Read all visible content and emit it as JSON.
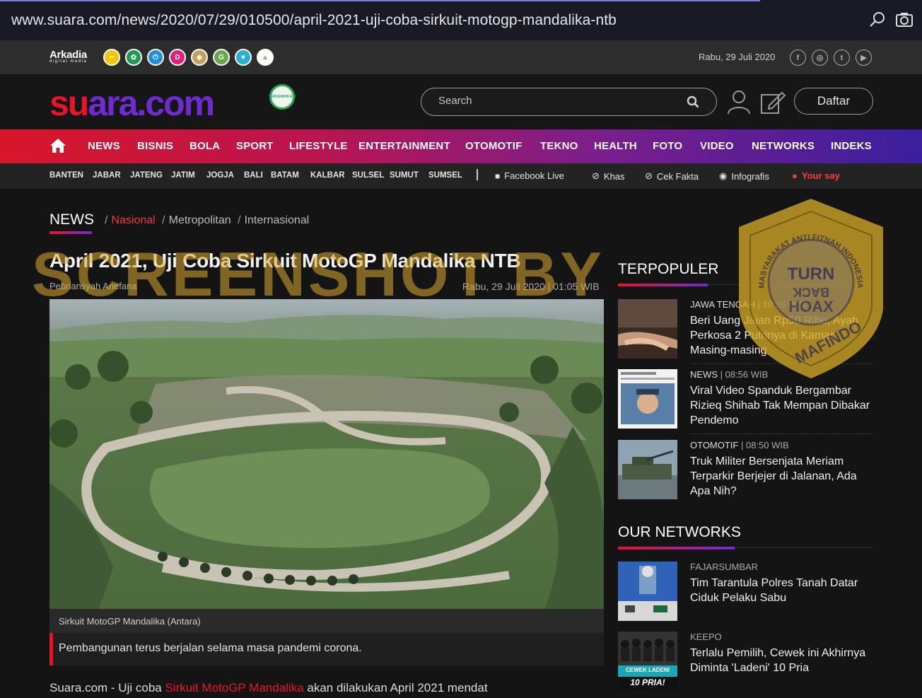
{
  "browser": {
    "url": "www.suara.com/news/2020/07/29/010500/april-2021-uji-coba-sirkuit-motogp-mandalika-ntb"
  },
  "topbar": {
    "arkadia": "Arkadia",
    "arkadia_sub": "digital media",
    "date": "Rabu, 29 Juli 2020",
    "brands": [
      "mata",
      "flower",
      "power",
      "D",
      "crest",
      "G",
      "chat",
      "triangle"
    ],
    "brand_colors": [
      "#f6c500",
      "#1d9a55",
      "#1f8fdc",
      "#e0207a",
      "#c7a05a",
      "#6aa84f",
      "#2ab0d0",
      "#ffffff"
    ],
    "social": [
      "facebook-icon",
      "instagram-icon",
      "twitter-icon",
      "youtube-icon"
    ]
  },
  "header": {
    "logo_part1": "su",
    "logo_part2": "ara",
    "logo_part3": ".com",
    "badge": "TERVERIFIKASI",
    "search_placeholder": "Search",
    "register_label": "Daftar"
  },
  "nav": {
    "items": [
      "NEWS",
      "BISNIS",
      "BOLA",
      "SPORT",
      "LIFESTYLE",
      "ENTERTAINMENT",
      "OTOMOTIF",
      "TEKNO",
      "HEALTH",
      "FOTO",
      "VIDEO",
      "NETWORKS",
      "INDEKS"
    ]
  },
  "subnav": {
    "regions": [
      "BANTEN",
      "JABAR",
      "JATENG",
      "JATIM",
      "JOGJA",
      "BALI",
      "BATAM",
      "KALBAR",
      "SULSEL",
      "SUMUT",
      "SUMSEL"
    ],
    "features": [
      "Facebook Live",
      "Khas",
      "Cek Fakta",
      "Infografis",
      "Your say"
    ]
  },
  "section": {
    "title": "NEWS",
    "crumbs": [
      "Nasional",
      "Metropolitan",
      "Internasional"
    ]
  },
  "article": {
    "title": "April 2021, Uji Coba Sirkuit MotoGP Mandalika NTB",
    "author": "Pebriansyah Ariefana",
    "date": "Rabu, 29 Juli 2020 | 01:05 WIB",
    "caption": "Sirkuit MotoGP Mandalika (Antara)",
    "lead": "Pembangunan terus berjalan selama masa pandemi corona.",
    "body_start": "Suara.com - Uji coba ",
    "body_link": "Sirkuit MotoGP Mandalika",
    "body_end": " akan dilakukan April 2021 mendat"
  },
  "watermark": "SCREENSHOT BY",
  "stamp": {
    "ring": "MASYARAKAT ANTI FITNAH INDONESIA",
    "center_1": "TURN",
    "center_2": "BACK",
    "center_3": "HOAX",
    "bottom": "MAFINDO"
  },
  "terpopuler": {
    "title": "TERPOPULER",
    "items": [
      {
        "cat": "JAWA TENGAH",
        "time": "10:26 WIB",
        "title": "Beri Uang Jajan Rp50 Ribu, Ayah Perkosa 2 Putrinya di Kamar Masing-masing"
      },
      {
        "cat": "NEWS",
        "time": "08:56 WIB",
        "title": "Viral Video Spanduk Bergambar Rizieq Shihab Tak Mempan Dibakar Pendemo"
      },
      {
        "cat": "OTOMOTIF",
        "time": "08:50 WIB",
        "title": "Truk Militer Bersenjata Meriam Terparkir Berjejer di Jalanan, Ada Apa Nih?"
      }
    ]
  },
  "networks": {
    "title": "OUR NETWORKS",
    "items": [
      {
        "source": "FAJARSUMBAR",
        "title": "Tim Tarantula Polres Tanah Datar Ciduk Pelaku Sabu"
      },
      {
        "source": "KEEPO",
        "title": "Terlalu Pemilih, Cewek ini Akhirnya Diminta 'Ladeni' 10 Pria",
        "thumb_text_1": "CEWEK LADENI",
        "thumb_text_2": "10 PRIA!"
      }
    ]
  }
}
